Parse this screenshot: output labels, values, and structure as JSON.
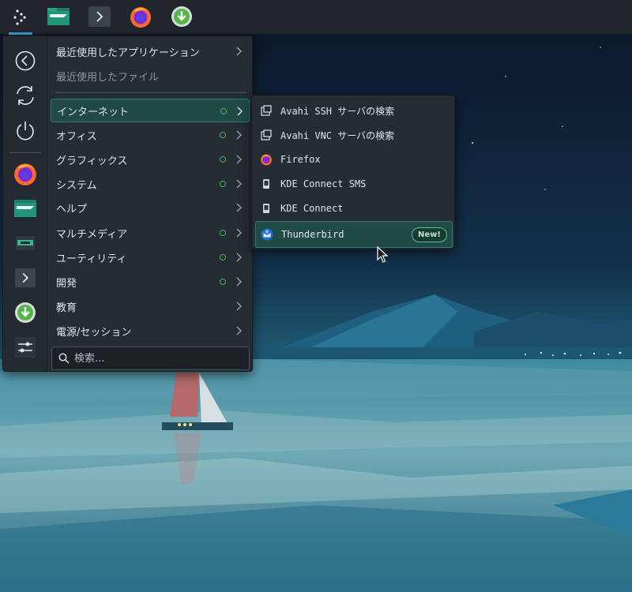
{
  "colors": {
    "accent": "#3daee9",
    "selection_bg": "#1f4a46",
    "selection_border": "#2f7a6f",
    "new_app_dot": "#42b35a",
    "menu_bg": "#252c33",
    "taskbar_bg": "#20262c"
  },
  "taskbar": {
    "items": [
      {
        "icon": "application-launcher-icon"
      },
      {
        "icon": "file-manager-icon"
      },
      {
        "icon": "terminal-icon"
      },
      {
        "icon": "firefox-icon"
      },
      {
        "icon": "software-center-icon"
      }
    ]
  },
  "favorites": [
    {
      "icon": "back-arrow-icon"
    },
    {
      "icon": "refresh-icon"
    },
    {
      "icon": "power-icon"
    },
    {
      "icon": "firefox-icon"
    },
    {
      "icon": "file-manager-icon"
    },
    {
      "icon": "device-manager-icon"
    },
    {
      "icon": "terminal-icon"
    },
    {
      "icon": "software-center-icon"
    },
    {
      "icon": "system-settings-icon"
    }
  ],
  "menu": {
    "items": [
      {
        "label": "最近使用したアプリケーション",
        "has_submenu": true,
        "new_dot": false
      },
      {
        "label": "最近使用したファイル",
        "has_submenu": false,
        "new_dot": false,
        "disabled": true
      },
      {
        "label": "インターネット",
        "has_submenu": true,
        "new_dot": true,
        "selected": true
      },
      {
        "label": "オフィス",
        "has_submenu": true,
        "new_dot": true
      },
      {
        "label": "グラフィックス",
        "has_submenu": true,
        "new_dot": true
      },
      {
        "label": "システム",
        "has_submenu": true,
        "new_dot": true
      },
      {
        "label": "ヘルプ",
        "has_submenu": true,
        "new_dot": false
      },
      {
        "label": "マルチメディア",
        "has_submenu": true,
        "new_dot": true
      },
      {
        "label": "ユーティリティ",
        "has_submenu": true,
        "new_dot": true
      },
      {
        "label": "開発",
        "has_submenu": true,
        "new_dot": true
      },
      {
        "label": "教育",
        "has_submenu": true,
        "new_dot": false
      },
      {
        "label": "電源/セッション",
        "has_submenu": true,
        "new_dot": false
      }
    ]
  },
  "search": {
    "placeholder": "検索...",
    "value": ""
  },
  "submenu": {
    "items": [
      {
        "label": "Avahi SSH サーバの検索",
        "icon": "network-browser-icon"
      },
      {
        "label": "Avahi VNC サーバの検索",
        "icon": "network-browser-icon"
      },
      {
        "label": "Firefox",
        "icon": "firefox-icon"
      },
      {
        "label": "KDE Connect SMS",
        "icon": "kdeconnect-icon"
      },
      {
        "label": "KDE Connect",
        "icon": "kdeconnect-icon"
      },
      {
        "label": "Thunderbird",
        "icon": "thunderbird-icon",
        "badge": "New!",
        "hovered": true
      }
    ]
  }
}
